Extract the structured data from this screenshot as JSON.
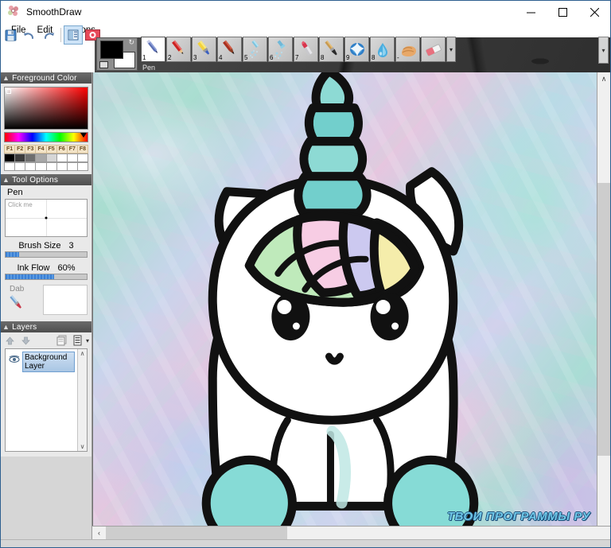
{
  "window": {
    "title": "SmoothDraw",
    "app_icon": "flower-icon",
    "minimize_label": "─",
    "maximize_label": "□",
    "close_label": "✕"
  },
  "menu": {
    "items": [
      {
        "label": "File",
        "name": "menu-file"
      },
      {
        "label": "Edit",
        "name": "menu-edit"
      },
      {
        "label": "Options",
        "name": "menu-options"
      }
    ]
  },
  "quickbar": {
    "buttons": [
      {
        "name": "save-button",
        "icon": "save-icon",
        "tooltip": "Save"
      },
      {
        "name": "undo-button",
        "icon": "undo-icon",
        "tooltip": "Undo"
      },
      {
        "name": "redo-button",
        "icon": "redo-icon",
        "tooltip": "Redo"
      },
      {
        "name": "panels-toggle-button",
        "icon": "panels-icon",
        "tooltip": "Panels"
      },
      {
        "name": "record-button",
        "icon": "record-icon",
        "tooltip": "Record"
      }
    ]
  },
  "color_widget": {
    "foreground": "#000000",
    "background": "#ffffff",
    "swap_icon": "swap-colors-icon",
    "reset_icon": "reset-colors-icon"
  },
  "tools": {
    "selected_label": "Pen",
    "more_label": "▾",
    "scroll_label": "▾",
    "items": [
      {
        "num": "1",
        "name": "tool-pen",
        "icon": "pen-icon",
        "label": "Pen",
        "selected": true
      },
      {
        "num": "2",
        "name": "tool-pencil",
        "icon": "pencil-icon",
        "label": "Pencil",
        "selected": false
      },
      {
        "num": "3",
        "name": "tool-marker",
        "icon": "marker-icon",
        "label": "Marker",
        "selected": false
      },
      {
        "num": "4",
        "name": "tool-crayon",
        "icon": "crayon-icon",
        "label": "Crayon",
        "selected": false
      },
      {
        "num": "5",
        "name": "tool-airbrush",
        "icon": "airbrush-icon",
        "label": "Airbrush",
        "selected": false
      },
      {
        "num": "6",
        "name": "tool-spray",
        "icon": "spray-icon",
        "label": "Spray",
        "selected": false
      },
      {
        "num": "7",
        "name": "tool-lipstick",
        "icon": "lipstick-icon",
        "label": "Lipstick",
        "selected": false
      },
      {
        "num": "8",
        "name": "tool-brush",
        "icon": "brush-icon",
        "label": "Brush",
        "selected": false
      },
      {
        "num": "9",
        "name": "tool-smudge",
        "icon": "smudge-icon",
        "label": "Smudge",
        "selected": false
      },
      {
        "num": "8",
        "name": "tool-water",
        "icon": "water-drop-icon",
        "label": "Water",
        "selected": false
      },
      {
        "num": "-",
        "name": "tool-finger",
        "icon": "finger-icon",
        "label": "Finger",
        "selected": false
      },
      {
        "num": "",
        "name": "tool-eraser",
        "icon": "eraser-icon",
        "label": "Eraser",
        "selected": false
      }
    ]
  },
  "panels": {
    "foreground_color": {
      "title": "Foreground Color",
      "collapse_icon": "chevron-up-icon",
      "preset_labels": [
        "F1",
        "F2",
        "F3",
        "F4",
        "F5",
        "F6",
        "F7",
        "F8"
      ],
      "preset_row1": [
        "#000000",
        "#3c3c3c",
        "#6e6e6e",
        "#a8a8a8",
        "#d6d6d6",
        "#ffffff",
        "#ffffff",
        "#ffffff"
      ],
      "preset_row2": [
        "#ffffff",
        "#ffffff",
        "#ffffff",
        "#ffffff",
        "#ffffff",
        "#ffffff",
        "#ffffff",
        "#ffffff"
      ],
      "hue_base": "#ff0000"
    },
    "tool_options": {
      "title": "Tool Options",
      "collapse_icon": "chevron-up-icon",
      "tool_name": "Pen",
      "canvas_hint": "Click me",
      "brush_size_label": "Brush Size",
      "brush_size_value": "3",
      "brush_size_percent": 17,
      "ink_flow_label": "Ink Flow",
      "ink_flow_value": "60%",
      "ink_flow_percent": 60,
      "dab_label": "Dab",
      "dab_icon": "brush-dab-icon"
    },
    "layers": {
      "title": "Layers",
      "collapse_icon": "chevron-up-icon",
      "move_up_icon": "arrow-up-icon",
      "move_down_icon": "arrow-down-icon",
      "properties_icon": "layer-properties-icon",
      "menu_icon": "layer-menu-icon",
      "menu_caret": "▾",
      "scroll_up": "∧",
      "scroll_down": "∨",
      "items": [
        {
          "name": "Background Layer",
          "visible_icon": "eye-icon",
          "selected": true
        }
      ]
    }
  },
  "canvas": {
    "artwork_name": "unicorn-drawing",
    "background_style": "holographic-pastel-gradient",
    "colors": {
      "horn": "#7fd9d2",
      "mane_green": "#b9e8b4",
      "mane_pink": "#f6c8e0",
      "mane_lavender": "#c9c6ee",
      "mane_yellow": "#f2e8a8",
      "body": "#ffffff",
      "hoof": "#7fd9d2",
      "outline": "#000000"
    },
    "scroll_left_arrow": "‹",
    "scroll_right_arrow": "›",
    "scroll_up_arrow": "∧",
    "scroll_down_arrow": "∨"
  },
  "watermark": {
    "text": "ТВОИ ПРОГРАММЫ РУ"
  }
}
